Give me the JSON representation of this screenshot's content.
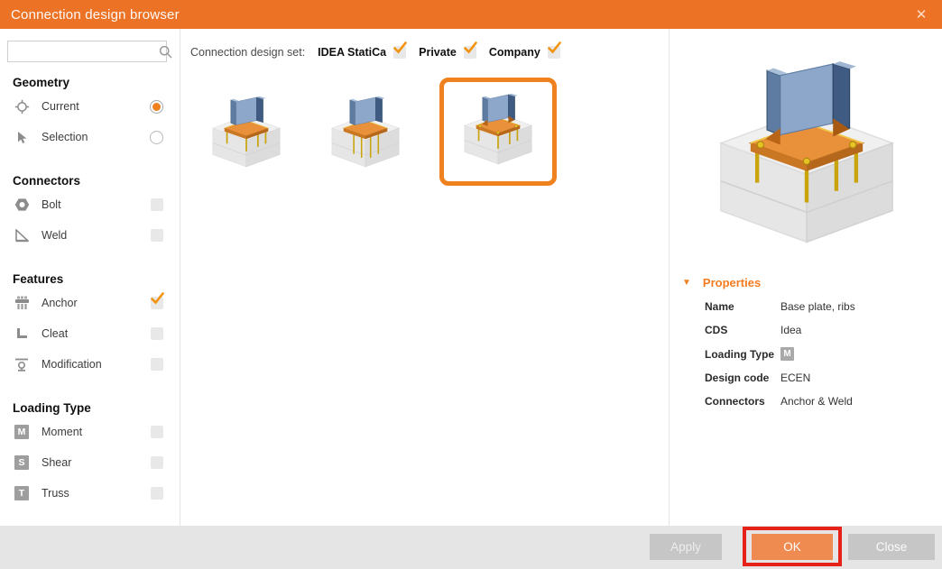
{
  "window": {
    "title": "Connection design browser",
    "close_glyph": "✕"
  },
  "colors": {
    "titlebar_orange": "#EC7326",
    "selection_orange": "#F0811F",
    "check_orange": "#F2930D",
    "properties_orange": "#F47B20",
    "ok_button_orange": "#EF8A50",
    "highlight_red": "#E62117"
  },
  "sidebar": {
    "search": {
      "value": "",
      "placeholder": ""
    },
    "sections": [
      {
        "title": "Geometry",
        "items": [
          {
            "label": "Current",
            "icon": "target-icon",
            "control": "radio",
            "checked": true
          },
          {
            "label": "Selection",
            "icon": "cursor-icon",
            "control": "radio",
            "checked": false
          }
        ]
      },
      {
        "title": "Connectors",
        "items": [
          {
            "label": "Bolt",
            "icon": "nut-icon",
            "control": "checkbox",
            "checked": false
          },
          {
            "label": "Weld",
            "icon": "weld-icon",
            "control": "checkbox",
            "checked": false
          }
        ]
      },
      {
        "title": "Features",
        "items": [
          {
            "label": "Anchor",
            "icon": "anchor-plate-icon",
            "control": "checkbox",
            "checked": true
          },
          {
            "label": "Cleat",
            "icon": "cleat-icon",
            "control": "checkbox",
            "checked": false
          },
          {
            "label": "Modification",
            "icon": "modification-icon",
            "control": "checkbox",
            "checked": false
          }
        ]
      },
      {
        "title": "Loading Type",
        "items": [
          {
            "label": "Moment",
            "badge": "M",
            "icon": "moment-badge-icon",
            "control": "checkbox",
            "checked": false
          },
          {
            "label": "Shear",
            "badge": "S",
            "icon": "shear-badge-icon",
            "control": "checkbox",
            "checked": false
          },
          {
            "label": "Truss",
            "badge": "T",
            "icon": "truss-badge-icon",
            "control": "checkbox",
            "checked": false
          }
        ]
      }
    ]
  },
  "design_set_bar": {
    "label": "Connection design set:",
    "sets": [
      {
        "name": "IDEA StatiCa",
        "checked": true
      },
      {
        "name": "Private",
        "checked": true
      },
      {
        "name": "Company",
        "checked": true
      }
    ]
  },
  "gallery": {
    "items": [
      {
        "selected": false
      },
      {
        "selected": false
      },
      {
        "selected": true
      }
    ]
  },
  "properties": {
    "header": "Properties",
    "rows": [
      {
        "label": "Name",
        "value": "Base plate, ribs"
      },
      {
        "label": "CDS",
        "value": "Idea"
      },
      {
        "label": "Loading Type",
        "value": "M",
        "is_badge": true
      },
      {
        "label": "Design code",
        "value": "ECEN"
      },
      {
        "label": "Connectors",
        "value": "Anchor & Weld"
      }
    ]
  },
  "footer": {
    "apply_label": "Apply",
    "ok_label": "OK",
    "close_label": "Close"
  }
}
